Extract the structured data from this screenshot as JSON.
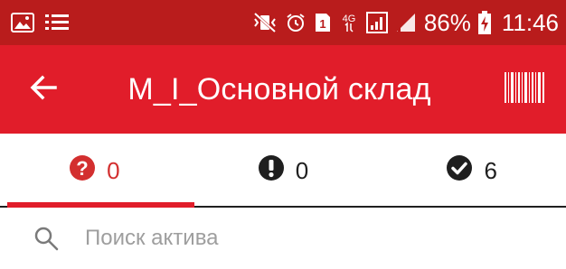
{
  "status_bar": {
    "left_icons": [
      "image-icon",
      "list-icon"
    ],
    "right_icons": [
      "mute-vibrate-icon",
      "alarm-icon",
      "sim-1-icon",
      "4g-icon",
      "signal-icon",
      "cellular-signal-icon"
    ],
    "battery": "86%",
    "time": "11:46"
  },
  "app_bar": {
    "title": "М_I_Основной склад",
    "back_icon": "arrow-back-icon",
    "action_icon": "barcode-icon"
  },
  "tabs": [
    {
      "icon": "question-circle-icon",
      "count": "0",
      "active": true
    },
    {
      "icon": "exclamation-circle-icon",
      "count": "0",
      "active": false
    },
    {
      "icon": "check-circle-icon",
      "count": "6",
      "active": false
    }
  ],
  "search": {
    "placeholder": "Поиск актива",
    "value": ""
  },
  "colors": {
    "status_bar": "#b91c1c",
    "app_bar": "#e11d2a",
    "active_tab": "#d32f2f",
    "indicator": "#e11d2a"
  }
}
